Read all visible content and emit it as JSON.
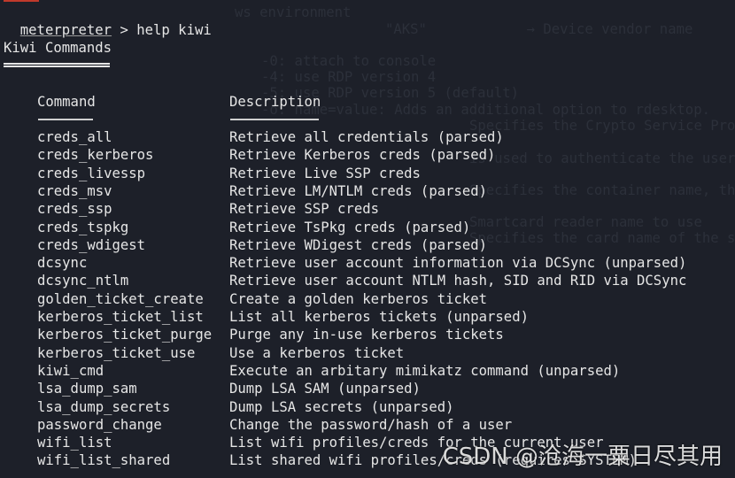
{
  "terminal": {
    "prompt": "meterpreter",
    "separator": " > ",
    "command": "help kiwi",
    "section_title": "Kiwi Commands",
    "headers": {
      "command": "Command",
      "description": "Description"
    },
    "rows": [
      {
        "command": "creds_all",
        "description": "Retrieve all credentials (parsed)"
      },
      {
        "command": "creds_kerberos",
        "description": "Retrieve Kerberos creds (parsed)"
      },
      {
        "command": "creds_livessp",
        "description": "Retrieve Live SSP creds"
      },
      {
        "command": "creds_msv",
        "description": "Retrieve LM/NTLM creds (parsed)"
      },
      {
        "command": "creds_ssp",
        "description": "Retrieve SSP creds"
      },
      {
        "command": "creds_tspkg",
        "description": "Retrieve TsPkg creds (parsed)"
      },
      {
        "command": "creds_wdigest",
        "description": "Retrieve WDigest creds (parsed)"
      },
      {
        "command": "dcsync",
        "description": "Retrieve user account information via DCSync (unparsed)"
      },
      {
        "command": "dcsync_ntlm",
        "description": "Retrieve user account NTLM hash, SID and RID via DCSync"
      },
      {
        "command": "golden_ticket_create",
        "description": "Create a golden kerberos ticket"
      },
      {
        "command": "kerberos_ticket_list",
        "description": "List all kerberos tickets (unparsed)"
      },
      {
        "command": "kerberos_ticket_purge",
        "description": "Purge any in-use kerberos tickets"
      },
      {
        "command": "kerberos_ticket_use",
        "description": "Use a kerberos ticket"
      },
      {
        "command": "kiwi_cmd",
        "description": "Execute an arbitary mimikatz command (unparsed)"
      },
      {
        "command": "lsa_dump_sam",
        "description": "Dump LSA SAM (unparsed)"
      },
      {
        "command": "lsa_dump_secrets",
        "description": "Dump LSA secrets (unparsed)"
      },
      {
        "command": "password_change",
        "description": "Change the password/hash of a user"
      },
      {
        "command": "wifi_list",
        "description": "List wifi profiles/creds for the current user"
      },
      {
        "command": "wifi_list_shared",
        "description": "List shared wifi profiles/creds (requires SYSTEM)"
      }
    ]
  },
  "background_ghost": [
    "ws environment",
    "\"AKS\"            → Device vendor name",
    "-0: attach to console",
    "-4: use RDP version 4",
    "-5: use RDP version 5 (default)",
    "-o: name=value: Adds an additional option to rdesktop.",
    "Specifies the Crypto Service Provid",
    "is used to authenticate the user by",
    "Specifies the container name, this",
    "Smartcard reader name to use",
    "Specifies the card name of the smar"
  ],
  "watermark": "CSDN @沧海一粟日尽其用",
  "colors": {
    "background": "#1d2029",
    "text": "#e6e6e6"
  }
}
